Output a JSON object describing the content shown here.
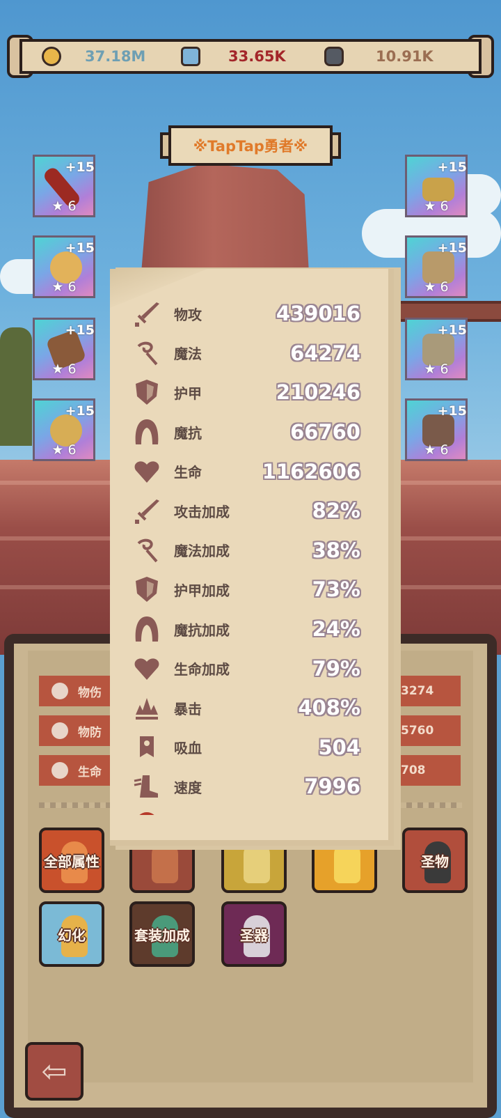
{
  "resources": [
    {
      "icon": "coin-icon",
      "value": "37.18M",
      "color": "#6e9fb3"
    },
    {
      "icon": "crystal-icon",
      "value": "33.65K",
      "color": "#a3262a"
    },
    {
      "icon": "rune-stone-icon",
      "value": "10.91K",
      "color": "#9b6e52"
    }
  ],
  "hero": {
    "title": "※TapTap勇者※"
  },
  "equipment": [
    {
      "slot": "weapon",
      "plus": "+15",
      "stars": "★ 6"
    },
    {
      "slot": "helmet",
      "plus": "+15",
      "stars": "★ 6"
    },
    {
      "slot": "ring",
      "plus": "+15",
      "stars": "★ 6"
    },
    {
      "slot": "armor",
      "plus": "+15",
      "stars": "★ 6"
    },
    {
      "slot": "necklace",
      "plus": "+15",
      "stars": "★ 6"
    },
    {
      "slot": "gloves",
      "plus": "+15",
      "stars": "★ 6"
    },
    {
      "slot": "earring",
      "plus": "+15",
      "stars": "★ 6"
    },
    {
      "slot": "boots",
      "plus": "+15",
      "stars": "★ 6"
    }
  ],
  "attributes": [
    {
      "icon": "sword-icon",
      "name": "物攻",
      "value": "439016"
    },
    {
      "icon": "magic-icon",
      "name": "魔法",
      "value": "64274"
    },
    {
      "icon": "shield-icon",
      "name": "护甲",
      "value": "210246"
    },
    {
      "icon": "hood-icon",
      "name": "魔抗",
      "value": "66760"
    },
    {
      "icon": "heart-icon",
      "name": "生命",
      "value": "1162606"
    },
    {
      "icon": "sword-icon",
      "name": "攻击加成",
      "value": "82%"
    },
    {
      "icon": "magic-icon",
      "name": "魔法加成",
      "value": "38%"
    },
    {
      "icon": "shield-icon",
      "name": "护甲加成",
      "value": "73%"
    },
    {
      "icon": "hood-icon",
      "name": "魔抗加成",
      "value": "24%"
    },
    {
      "icon": "heart-icon",
      "name": "生命加成",
      "value": "79%"
    },
    {
      "icon": "crit-icon",
      "name": "暴击",
      "value": "408%"
    },
    {
      "icon": "lifesteal-icon",
      "name": "吸血",
      "value": "504"
    },
    {
      "icon": "speed-boot-icon",
      "name": "速度",
      "value": "7996"
    }
  ],
  "panel_stats": [
    {
      "icon": "sword-icon",
      "label": "物伤",
      "value": "3274"
    },
    {
      "icon": "shield-icon",
      "label": "物防",
      "value": "5760"
    },
    {
      "icon": "heart-icon",
      "label": "生命",
      "value": "708"
    }
  ],
  "menu": [
    {
      "label": "全部属性",
      "bg": "#c9512c"
    },
    {
      "label": "",
      "bg": "#9a4a3a"
    },
    {
      "label": "",
      "bg": "#c8a53a"
    },
    {
      "label": "",
      "bg": "#e6a12a"
    },
    {
      "label": "圣物",
      "bg": "#b14e3c"
    },
    {
      "label": "幻化",
      "bg": "#7bbad6"
    },
    {
      "label": "套装加成",
      "bg": "#5e3b2c"
    },
    {
      "label": "圣器",
      "bg": "#6e2a55"
    }
  ],
  "colors": {
    "accent": "#e07a2a",
    "panel": "#c9b591",
    "popup": "#ead9ba",
    "chip": "#b7553f"
  }
}
